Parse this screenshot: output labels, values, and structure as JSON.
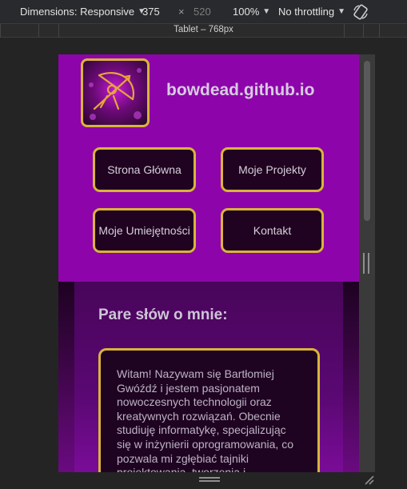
{
  "devtools": {
    "dimensions_label": "Dimensions: Responsive",
    "width_value": "375",
    "height_placeholder": "520",
    "times_sign": "×",
    "zoom": "100%",
    "throttling": "No throttling",
    "media_query_label": "Tablet – 768px"
  },
  "site": {
    "title": "bowdead.github.io",
    "nav": [
      {
        "label": "Strona Główna"
      },
      {
        "label": "Moje Projekty"
      },
      {
        "label": "Moje Umiejętności"
      },
      {
        "label": "Kontakt"
      }
    ],
    "about_title": "Pare słów o mnie:",
    "about_text": "Witam! Nazywam się Bartłomiej Gwóźdź i jestem pasjonatem nowoczesnych technologii oraz kreatywnych rozwiązań. Obecnie studiuję informatykę, specjalizując się w inżynierii oprogramowania, co pozwala mi zgłębiać tajniki projektowania, tworzenia i"
  },
  "colors": {
    "header_purple": "#8d05aa",
    "gold_border": "#d9b43a",
    "button_bg": "#1f0320"
  }
}
